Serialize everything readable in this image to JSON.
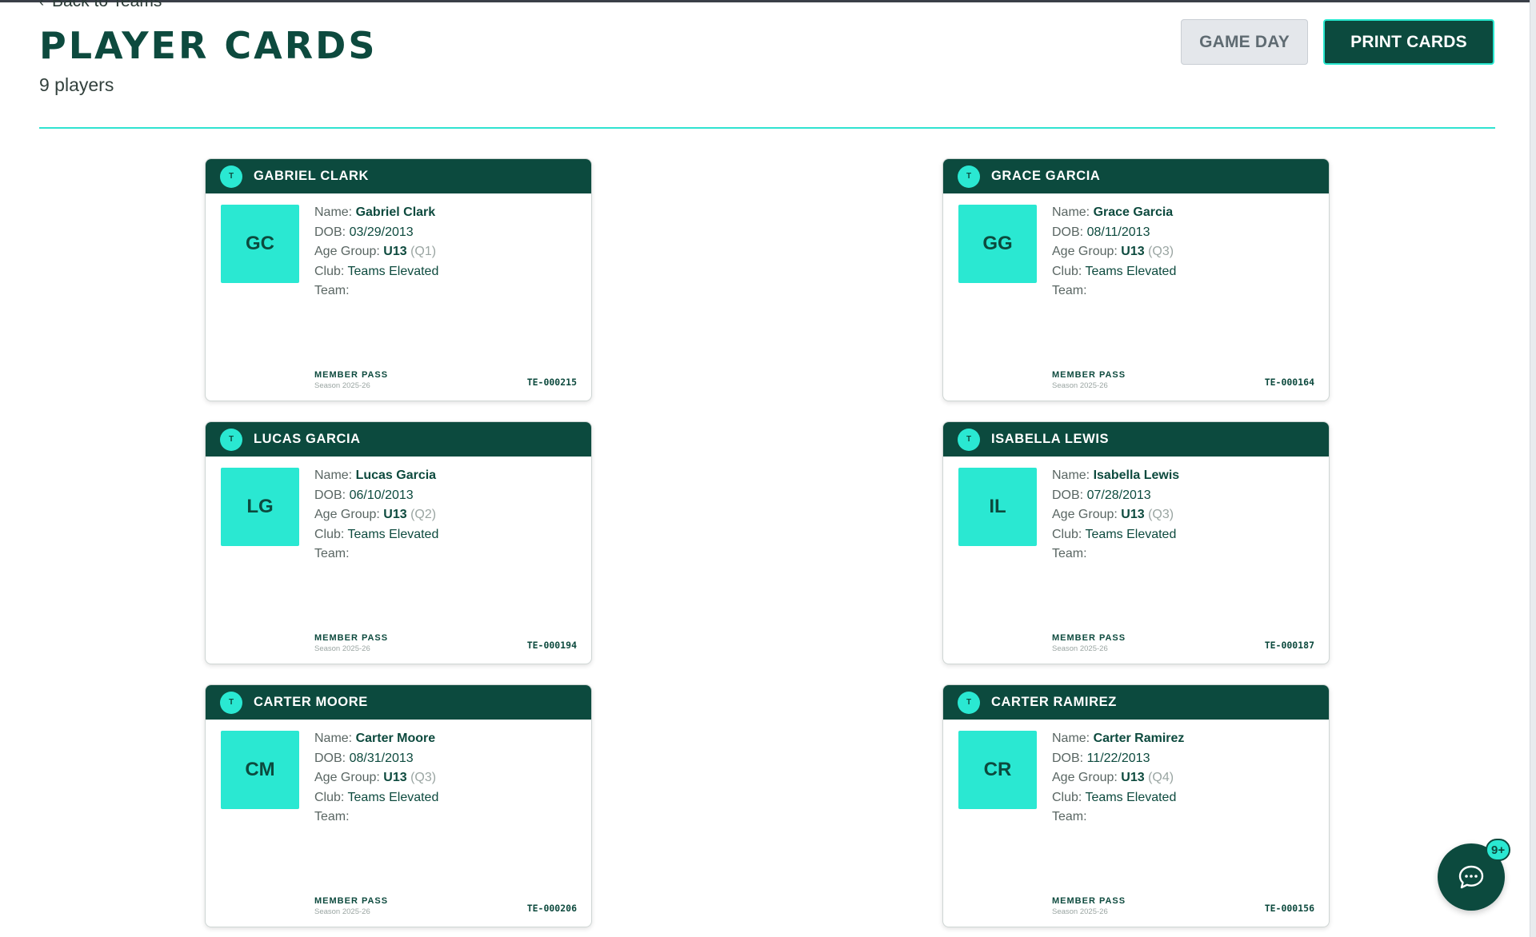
{
  "nav": {
    "back_label": "Back to Teams"
  },
  "header": {
    "title": "PLAYER CARDS",
    "count": "9 players",
    "game_day_label": "GAME DAY",
    "print_label": "PRINT CARDS"
  },
  "card_common": {
    "name_label": "Name:",
    "dob_label": "DOB:",
    "age_label": "Age Group:",
    "club_label": "Club:",
    "team_label": "Team:",
    "header_badge": "T",
    "member_pass": "MEMBER PASS",
    "season": "Season 2025-26"
  },
  "cards": [
    {
      "header_name": "GABRIEL CLARK",
      "initials": "GC",
      "name": "Gabriel Clark",
      "dob": "03/29/2013",
      "age_group": "U13",
      "quarter": "(Q1)",
      "club": "Teams Elevated",
      "team": "",
      "id": "TE-000215"
    },
    {
      "header_name": "GRACE GARCIA",
      "initials": "GG",
      "name": "Grace Garcia",
      "dob": "08/11/2013",
      "age_group": "U13",
      "quarter": "(Q3)",
      "club": "Teams Elevated",
      "team": "",
      "id": "TE-000164"
    },
    {
      "header_name": "LUCAS GARCIA",
      "initials": "LG",
      "name": "Lucas Garcia",
      "dob": "06/10/2013",
      "age_group": "U13",
      "quarter": "(Q2)",
      "club": "Teams Elevated",
      "team": "",
      "id": "TE-000194"
    },
    {
      "header_name": "ISABELLA LEWIS",
      "initials": "IL",
      "name": "Isabella Lewis",
      "dob": "07/28/2013",
      "age_group": "U13",
      "quarter": "(Q3)",
      "club": "Teams Elevated",
      "team": "",
      "id": "TE-000187"
    },
    {
      "header_name": "CARTER MOORE",
      "initials": "CM",
      "name": "Carter Moore",
      "dob": "08/31/2013",
      "age_group": "U13",
      "quarter": "(Q3)",
      "club": "Teams Elevated",
      "team": "",
      "id": "TE-000206"
    },
    {
      "header_name": "CARTER RAMIREZ",
      "initials": "CR",
      "name": "Carter Ramirez",
      "dob": "11/22/2013",
      "age_group": "U13",
      "quarter": "(Q4)",
      "club": "Teams Elevated",
      "team": "",
      "id": "TE-000156"
    }
  ],
  "chat": {
    "badge": "9+",
    "icon": "chat-bubble-icon"
  },
  "colors": {
    "brand_dark": "#0c4a3e",
    "accent": "#2ae8d2"
  }
}
